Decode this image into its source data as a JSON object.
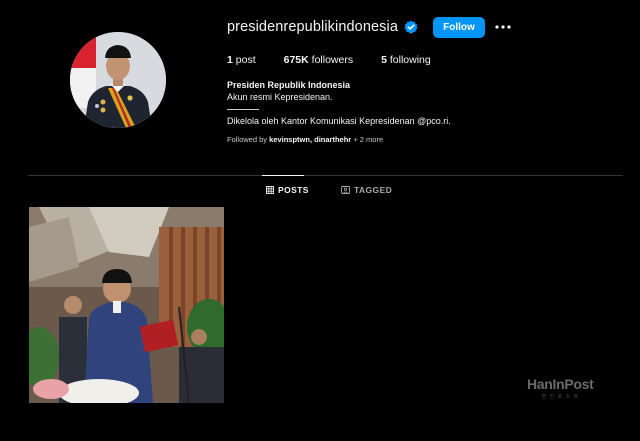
{
  "profile": {
    "username": "presidenrepublikindonesia",
    "follow_label": "Follow",
    "stats": {
      "posts_count": "1",
      "posts_label": "post",
      "followers_count": "675K",
      "followers_label": "followers",
      "following_count": "5",
      "following_label": "following"
    },
    "bio": {
      "name": "Presiden Republik Indonesia",
      "line1": "Akun resmi Kepresidenan.",
      "managed_by": "Dikelola oleh Kantor Komunikasi Kepresidenan @pco.ri."
    },
    "followed_by": {
      "prefix": "Followed by",
      "names": "kevinsptwn, dinarthehr",
      "suffix": "+ 2 more"
    }
  },
  "tabs": {
    "posts_label": "POSTS",
    "tagged_label": "TAGGED"
  },
  "icons": {
    "verified": "verified-badge-icon",
    "more": "more-options-icon",
    "posts": "grid-icon",
    "tagged": "tagged-icon"
  },
  "colors": {
    "background": "#000000",
    "follow_button": "#0095f6",
    "verified_badge": "#0095f6",
    "text_primary": "#f5f5f5",
    "text_secondary": "#a8a8a8",
    "divider": "#363636"
  },
  "watermark": {
    "main": "HanInPost",
    "sub": "한 인 포 스 트"
  }
}
